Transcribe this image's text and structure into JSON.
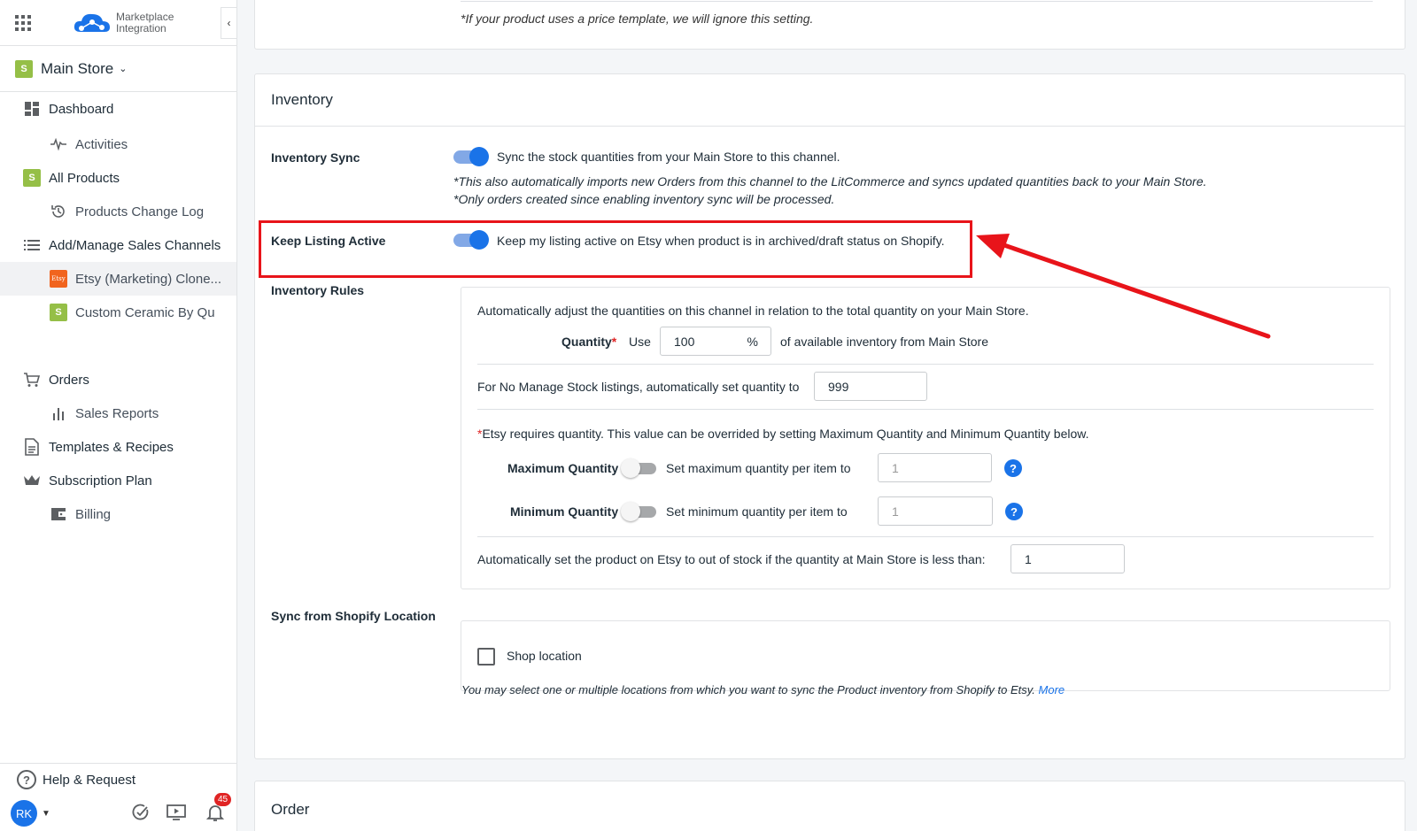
{
  "header": {
    "logo_line1": "Marketplace",
    "logo_line2": "Integration"
  },
  "store": {
    "name": "Main Store"
  },
  "nav": {
    "dashboard": "Dashboard",
    "activities": "Activities",
    "all_products": "All Products",
    "products_change_log": "Products Change Log",
    "sales_channels": "Add/Manage Sales Channels",
    "etsy_channel": "Etsy (Marketing) Clone...",
    "etsy_badge": "Etsy",
    "custom_ceramic": "Custom Ceramic By Qu",
    "orders": "Orders",
    "sales_reports": "Sales Reports",
    "templates": "Templates & Recipes",
    "subscription": "Subscription Plan",
    "billing": "Billing"
  },
  "footer": {
    "help": "Help & Request",
    "avatar": "RK",
    "notifications": "45"
  },
  "price_note": "*If your product uses a price template, we will ignore this setting.",
  "inventory": {
    "title": "Inventory",
    "sync_label": "Inventory Sync",
    "sync_text": "Sync the stock quantities from your Main Store to this channel.",
    "sync_note1": "*This also automatically imports new Orders from this channel to the LitCommerce and syncs updated quantities back to your Main Store.",
    "sync_note2": "*Only orders created since enabling inventory sync will be processed.",
    "keep_label": "Keep Listing Active",
    "keep_text": "Keep my listing active on Etsy when product is in archived/draft status on Shopify.",
    "rules_label": "Inventory Rules",
    "rules_intro": "Automatically adjust the quantities on this channel in relation to the total quantity on your Main Store.",
    "quantity_label": "Quantity",
    "required_mark": "*",
    "use_label": "Use",
    "quantity_value": "100",
    "percent": "%",
    "quantity_suffix": "of available inventory from Main Store",
    "no_manage_text": "For No Manage Stock listings, automatically set quantity to",
    "no_manage_value": "999",
    "etsy_requires": "Etsy requires quantity. This value can be overrided by setting Maximum Quantity and Minimum Quantity below.",
    "max_label": "Maximum Quantity",
    "max_text": "Set maximum quantity per item to",
    "max_value": "1",
    "min_label": "Minimum Quantity",
    "min_text": "Set minimum quantity per item to",
    "min_value": "1",
    "out_of_stock_text": "Automatically set the product on Etsy to out of stock if the quantity at Main Store is less than:",
    "out_of_stock_value": "1",
    "location_label": "Sync from Shopify Location",
    "shop_location": "Shop location",
    "location_note": "You may select one or multiple locations from which you want to sync the Product inventory from Shopify to Etsy.",
    "more_link": "More"
  },
  "order": {
    "title": "Order"
  },
  "colors": {
    "accent": "#1a73e8",
    "highlight": "#e8141a",
    "shopify": "#95bf47",
    "etsy": "#f1641e"
  }
}
